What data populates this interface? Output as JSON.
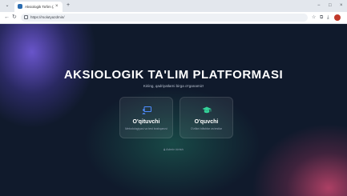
{
  "browser": {
    "tab_title": "Aksiologik Ta'lim (Aksiol...",
    "tab_close": "×",
    "new_tab": "+",
    "url": "https://rsolutyazdmin/",
    "window_controls": [
      "−",
      "□",
      "×"
    ]
  },
  "page": {
    "title": "AKSIOLOGIK TA'LIM PLATFORMASI",
    "subtitle": "Kiriing, qadriyatlarni birga o'rganamiz!",
    "cards": [
      {
        "title": "O'qituvchi",
        "description": "Metodologiyasi va test boshqaruvi",
        "icon": "teacher-board-icon",
        "color": "#4f8cff"
      },
      {
        "title": "O'quvchi",
        "description": "O'zlikni bilishlar va testlar",
        "icon": "graduation-cap-icon",
        "color": "#34d399"
      }
    ],
    "admin_link": "Admin kirish"
  }
}
